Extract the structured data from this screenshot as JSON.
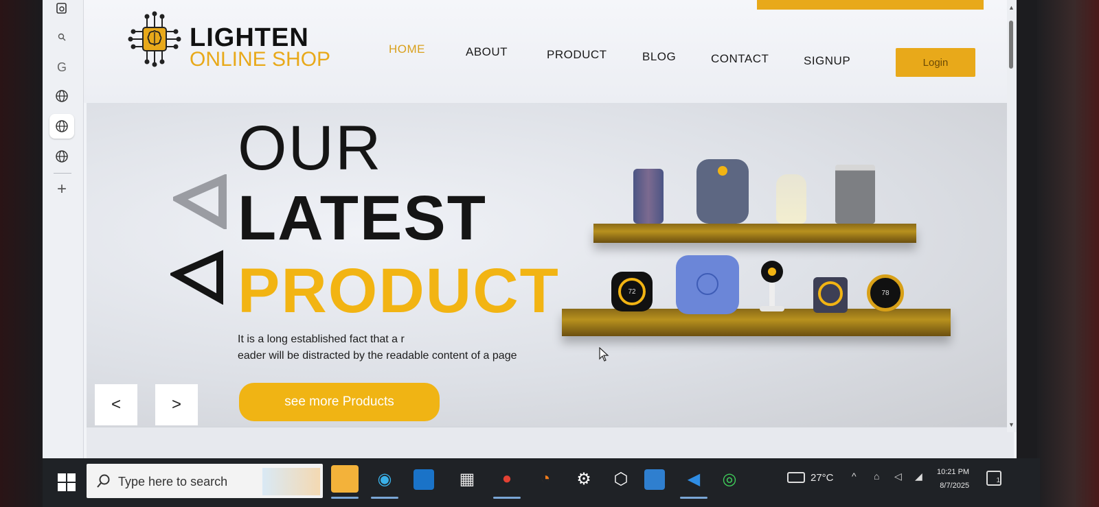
{
  "brand": {
    "name_line1": "LIGHTEN",
    "name_line2": "ONLINE SHOP",
    "accent_color": "#e8a91a"
  },
  "nav": {
    "items": [
      "HOME",
      "ABOUT",
      "PRODUCT",
      "BLOG",
      "CONTACT",
      "SIGNUP"
    ],
    "active": "HOME",
    "login_label": "Login"
  },
  "hero": {
    "title_line1": "OUR",
    "title_line2": "LATEST",
    "title_line3": "PRODUCT",
    "desc_line1": "It is a long established fact that a r",
    "desc_line2": "eader will be distracted by the readable content of a page",
    "cta_label": "see more Products",
    "prev_label": "<",
    "next_label": ">",
    "thermostat_readings": [
      "72",
      "78"
    ]
  },
  "sidebar": {
    "icons": [
      "new-tab-icon",
      "search-icon",
      "g-icon",
      "globe-icon",
      "globe-icon",
      "globe-icon",
      "plus-icon"
    ],
    "g_label": "G",
    "plus_label": "+"
  },
  "taskbar": {
    "search_placeholder": "Type here to search",
    "temperature": "27°C",
    "time": "10:21 PM",
    "date": "8/7/2025",
    "notification_count": "1"
  }
}
